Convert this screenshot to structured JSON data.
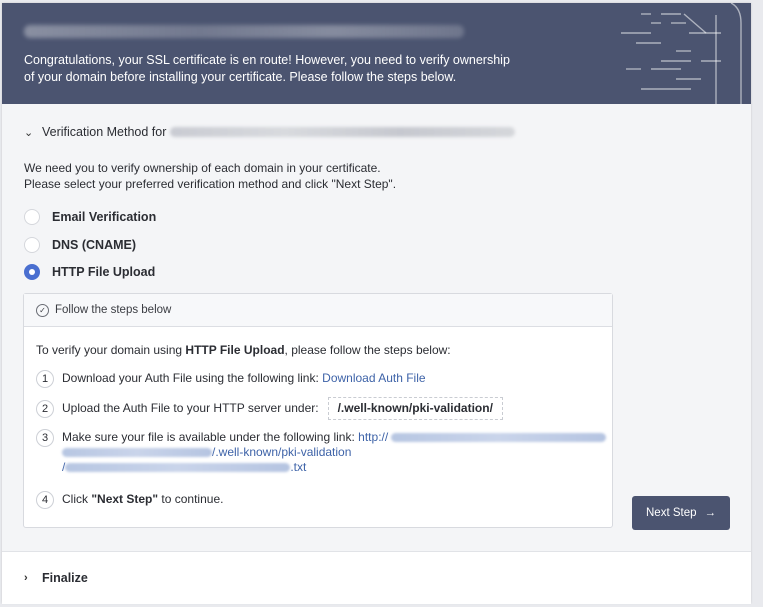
{
  "header": {
    "title_blurred": "",
    "message_line1": "Congratulations, your SSL certificate is en route! However, you need to verify ownership",
    "message_line2": "of your domain before installing your certificate. Please follow the steps below."
  },
  "verification": {
    "heading": "Verification Method for",
    "intro_line1": "We need you to verify ownership of each domain in your certificate.",
    "intro_line2": "Please select your preferred verification method and click \"Next Step\".",
    "options": [
      {
        "label": "Email Verification",
        "selected": false
      },
      {
        "label": "DNS (CNAME)",
        "selected": false
      },
      {
        "label": "HTTP File Upload",
        "selected": true
      }
    ]
  },
  "steps_panel": {
    "title": "Follow the steps below",
    "lead_prefix": "To verify your domain using ",
    "lead_method": "HTTP File Upload",
    "lead_suffix": ", please follow the steps below:",
    "steps": [
      {
        "num": "1",
        "text": "Download your Auth File using the following link:",
        "link": "Download Auth File"
      },
      {
        "num": "2",
        "text": "Upload the Auth File to your HTTP server under:",
        "path": "/.well-known/pki-validation/"
      },
      {
        "num": "3",
        "text": "Make sure your file is available under the following link:",
        "link_start": "http://",
        "link_mid": "/.well-known/pki-validation",
        "link_slash": "/",
        "link_end": ".txt"
      },
      {
        "num": "4",
        "text_prefix": "Click ",
        "text_bold": "\"Next Step\"",
        "text_suffix": " to continue."
      }
    ]
  },
  "buttons": {
    "next_step": "Next Step",
    "next_arrow": "→"
  },
  "finalize": {
    "label": "Finalize"
  },
  "icons": {
    "expanded": "chevron-down",
    "collapsed": "chevron-right",
    "check": "check-circle"
  },
  "colors": {
    "header_bg": "#4b5470",
    "accent": "#4a6fd0",
    "link": "#3e63a8"
  }
}
